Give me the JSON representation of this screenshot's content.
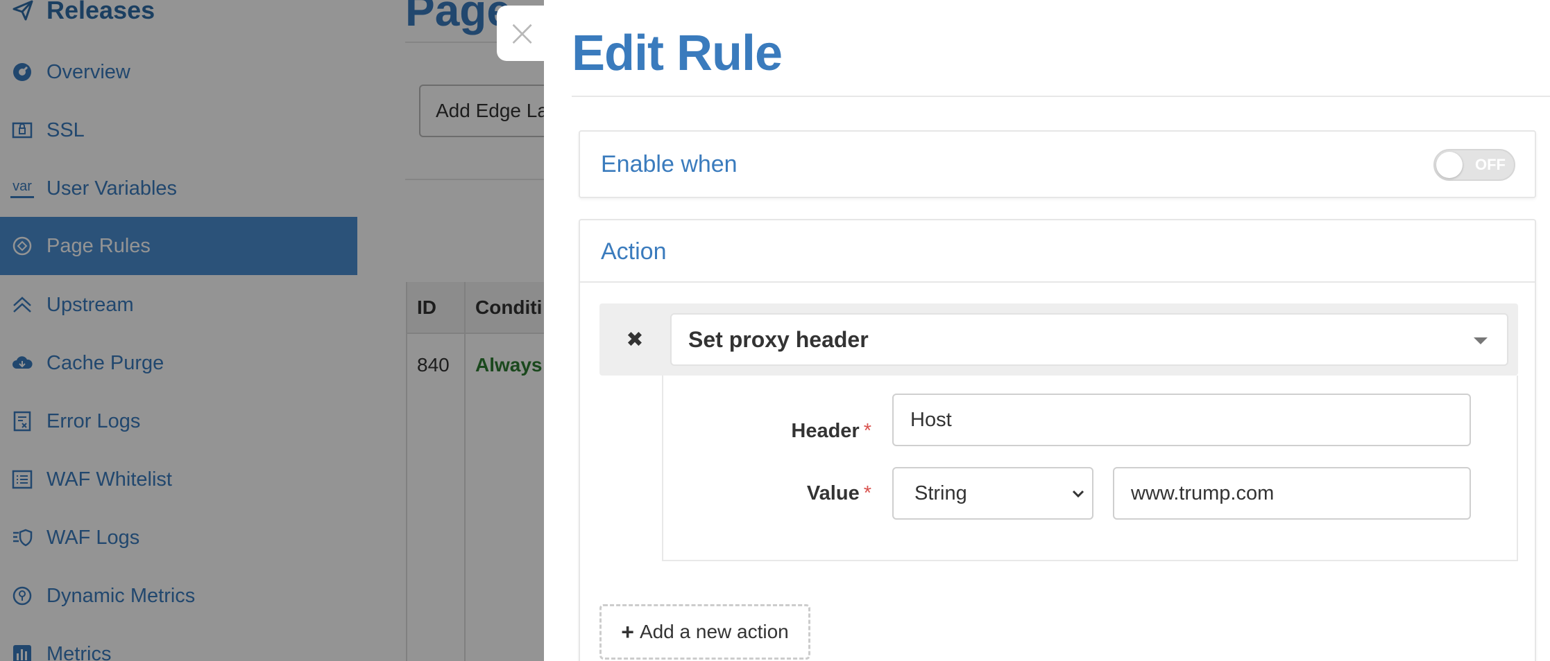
{
  "sidebar": {
    "heading": "Releases",
    "items": [
      {
        "label": "Overview",
        "icon": "dashboard-icon",
        "active": false
      },
      {
        "label": "SSL",
        "icon": "certificate-icon",
        "active": false
      },
      {
        "label": "User Variables",
        "icon": "var-icon",
        "icon_text": "var",
        "active": false
      },
      {
        "label": "Page Rules",
        "icon": "rules-icon",
        "active": true
      },
      {
        "label": "Upstream",
        "icon": "upstream-icon",
        "active": false
      },
      {
        "label": "Cache Purge",
        "icon": "cloud-icon",
        "active": false
      },
      {
        "label": "Error Logs",
        "icon": "error-log-icon",
        "active": false
      },
      {
        "label": "WAF Whitelist",
        "icon": "list-icon",
        "active": false
      },
      {
        "label": "WAF Logs",
        "icon": "waf-logs-icon",
        "active": false
      },
      {
        "label": "Dynamic Metrics",
        "icon": "dynamic-metrics-icon",
        "active": false
      },
      {
        "label": "Metrics",
        "icon": "bar-chart-icon",
        "active": false
      }
    ]
  },
  "background": {
    "page_title": "Page",
    "add_button": "Add Edge La",
    "table": {
      "headers": [
        "ID",
        "Conditi"
      ],
      "rows": [
        [
          "840",
          "Always"
        ]
      ]
    }
  },
  "drawer": {
    "close_label": "×",
    "title": "Edit Rule",
    "enable_panel": {
      "title": "Enable when",
      "toggle_label": "OFF",
      "toggle_on": false
    },
    "action_panel": {
      "title": "Action",
      "remove_label": "✖",
      "action_type": "Set proxy header",
      "fields": {
        "header_label": "Header",
        "header_value": "Host",
        "value_label": "Value",
        "value_type": "String",
        "value_value": "www.trump.com",
        "required_mark": "*"
      },
      "add_action_label": "Add a new action",
      "add_action_plus": "+"
    }
  },
  "colors": {
    "accent": "#3a7bbd",
    "active_bg": "#4a8ed0",
    "required": "#d9534f",
    "success_text": "#2e7d32"
  }
}
